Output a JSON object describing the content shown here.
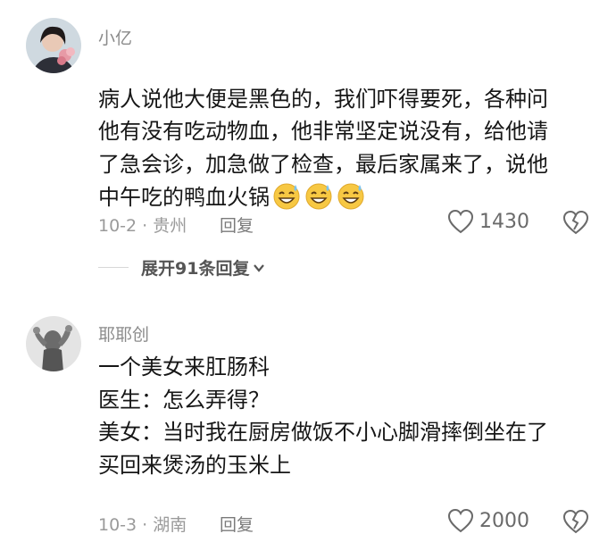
{
  "comments": [
    {
      "username": "小亿",
      "text": "病人说他大便是黑色的，我们吓得要死，各种问\n他有没有吃动物血，他非常坚定说没有，给他请\n了急会诊，加急做了检查，最后家属来了，说他\n中午吃的鸭血火锅",
      "emojis": [
        "grin-sweat-emoji",
        "grin-sweat-emoji",
        "grin-sweat-emoji"
      ],
      "meta": "10-2 · 贵州",
      "reply_label": "回复",
      "like_count": "1430",
      "expand_label": "展开91条回复"
    },
    {
      "username": "耶耶创",
      "text": "一个美女来肛肠科\n医生：怎么弄得？\n美女：当时我在厨房做饭不小心脚滑摔倒坐在了\n买回来煲汤的玉米上",
      "meta": "10-3 · 湖南",
      "reply_label": "回复",
      "like_count": "2000"
    }
  ],
  "colors": {
    "text": "#161616",
    "muted": "#9a9a9a",
    "emoji_face": "#f7c843"
  }
}
